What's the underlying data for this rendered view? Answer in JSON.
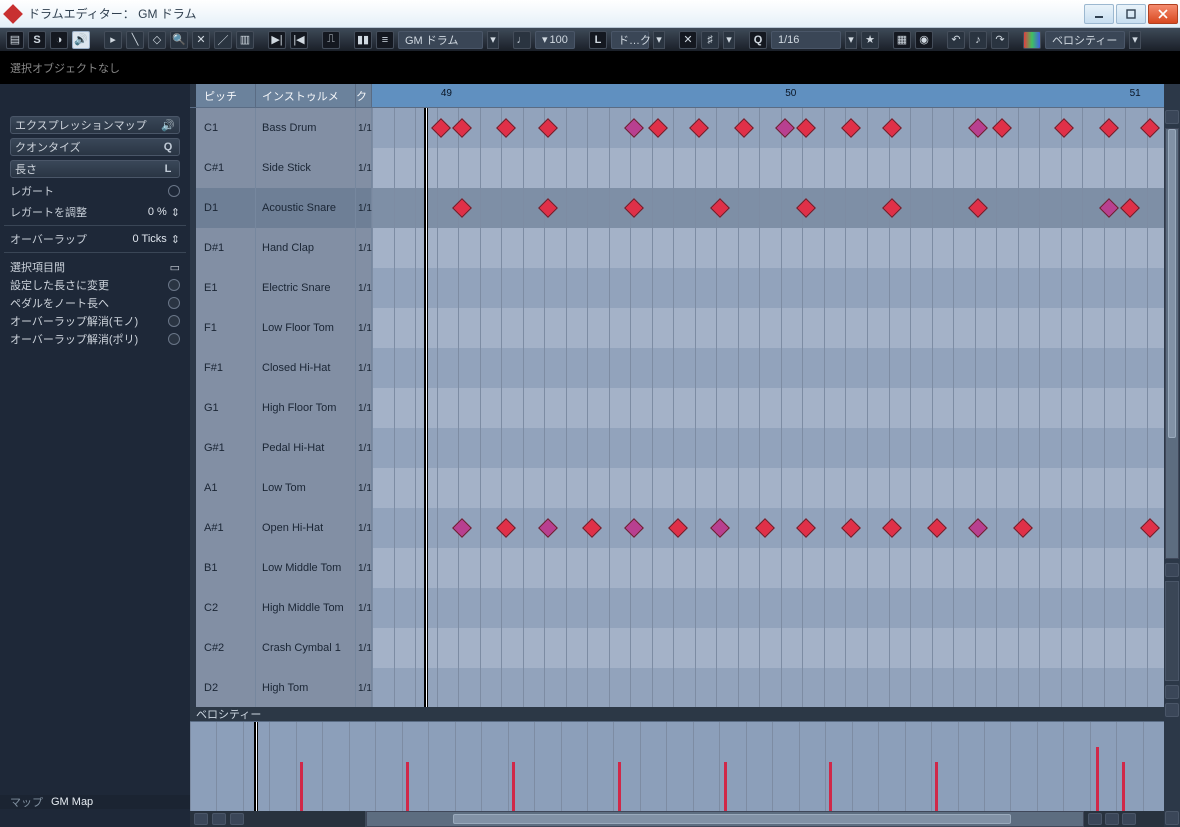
{
  "title": "ドラムエディター： GM ドラム",
  "toolbar": {
    "mapLabel": "GM ドラム",
    "tempo": "100",
    "lenLabel": "ド…ク",
    "snap": "1/16",
    "velField": "ベロシティー"
  },
  "infobar": "選択オブジェクトなし",
  "sidebar": {
    "expressionMap": "エクスプレッションマップ",
    "quantize": "クオンタイズ",
    "length": "長さ",
    "legato": "レガート",
    "legatoAdjust": "レガートを調整",
    "legatoAdjustVal": "0 %",
    "overlap": "オーバーラップ",
    "overlapVal": "0 Ticks",
    "selection": "選択項目間",
    "actions": [
      "設定した長さに変更",
      "ペダルをノート長へ",
      "オーバーラップ解消(モノ)",
      "オーバーラップ解消(ポリ)"
    ],
    "bottomMap": "マップ",
    "bottomMapVal": "GM Map",
    "velLabel": "ベロシティー"
  },
  "headers": {
    "pitch": "ピッチ",
    "instrument": "インストゥルメ",
    "q": "ク"
  },
  "ruler": {
    "t49": "49",
    "t50": "50",
    "t51": "51"
  },
  "rows": [
    {
      "pitch": "C1",
      "instr": "Bass Drum",
      "q": "1/1"
    },
    {
      "pitch": "C#1",
      "instr": "Side Stick",
      "q": "1/1"
    },
    {
      "pitch": "D1",
      "instr": "Acoustic Snare",
      "q": "1/1"
    },
    {
      "pitch": "D#1",
      "instr": "Hand Clap",
      "q": "1/1"
    },
    {
      "pitch": "E1",
      "instr": "Electric Snare",
      "q": "1/1"
    },
    {
      "pitch": "F1",
      "instr": "Low Floor Tom",
      "q": "1/1"
    },
    {
      "pitch": "F#1",
      "instr": "Closed Hi-Hat",
      "q": "1/1"
    },
    {
      "pitch": "G1",
      "instr": "High Floor Tom",
      "q": "1/1"
    },
    {
      "pitch": "G#1",
      "instr": "Pedal Hi-Hat",
      "q": "1/1"
    },
    {
      "pitch": "A1",
      "instr": "Low Tom",
      "q": "1/1"
    },
    {
      "pitch": "A#1",
      "instr": "Open Hi-Hat",
      "q": "1/1"
    },
    {
      "pitch": "B1",
      "instr": "Low Middle Tom",
      "q": "1/1"
    },
    {
      "pitch": "C2",
      "instr": "High Middle Tom",
      "q": "1/1"
    },
    {
      "pitch": "C#2",
      "instr": "Crash Cymbal 1",
      "q": "1/1"
    },
    {
      "pitch": "D2",
      "instr": "High Tom",
      "q": "1/1"
    }
  ],
  "grid": {
    "startTick": 48.8,
    "endTick": 51.1,
    "playhead": 48.95,
    "bars": [
      49,
      50,
      51
    ],
    "subdiv": 16,
    "events": {
      "0": [
        {
          "t": 49.0,
          "c": "r"
        },
        {
          "t": 49.06,
          "c": "r"
        },
        {
          "t": 49.19,
          "c": "r"
        },
        {
          "t": 49.31,
          "c": "r"
        },
        {
          "t": 49.56,
          "c": "m"
        },
        {
          "t": 49.63,
          "c": "r"
        },
        {
          "t": 49.75,
          "c": "r"
        },
        {
          "t": 49.88,
          "c": "r"
        },
        {
          "t": 50.0,
          "c": "m"
        },
        {
          "t": 50.06,
          "c": "r"
        },
        {
          "t": 50.19,
          "c": "r"
        },
        {
          "t": 50.31,
          "c": "r"
        },
        {
          "t": 50.56,
          "c": "m"
        },
        {
          "t": 50.63,
          "c": "r"
        },
        {
          "t": 50.81,
          "c": "r"
        },
        {
          "t": 50.94,
          "c": "r"
        },
        {
          "t": 51.06,
          "c": "r"
        }
      ],
      "2": [
        {
          "t": 49.06,
          "c": "r"
        },
        {
          "t": 49.31,
          "c": "r"
        },
        {
          "t": 49.56,
          "c": "r"
        },
        {
          "t": 49.81,
          "c": "r"
        },
        {
          "t": 50.06,
          "c": "r"
        },
        {
          "t": 50.31,
          "c": "r"
        },
        {
          "t": 50.56,
          "c": "r"
        },
        {
          "t": 50.94,
          "c": "m"
        },
        {
          "t": 51.0,
          "c": "r"
        }
      ],
      "10": [
        {
          "t": 49.06,
          "c": "m"
        },
        {
          "t": 49.19,
          "c": "r"
        },
        {
          "t": 49.31,
          "c": "m"
        },
        {
          "t": 49.44,
          "c": "r"
        },
        {
          "t": 49.56,
          "c": "m"
        },
        {
          "t": 49.69,
          "c": "r"
        },
        {
          "t": 49.81,
          "c": "m"
        },
        {
          "t": 49.94,
          "c": "r"
        },
        {
          "t": 50.06,
          "c": "r"
        },
        {
          "t": 50.19,
          "c": "r"
        },
        {
          "t": 50.31,
          "c": "r"
        },
        {
          "t": 50.44,
          "c": "r"
        },
        {
          "t": 50.56,
          "c": "m"
        },
        {
          "t": 50.69,
          "c": "r"
        },
        {
          "t": 51.06,
          "c": "r"
        }
      ]
    }
  },
  "velocity": [
    {
      "t": 49.06,
      "h": 0.55
    },
    {
      "t": 49.31,
      "h": 0.55
    },
    {
      "t": 49.56,
      "h": 0.55
    },
    {
      "t": 49.81,
      "h": 0.55
    },
    {
      "t": 50.06,
      "h": 0.55
    },
    {
      "t": 50.31,
      "h": 0.55
    },
    {
      "t": 50.56,
      "h": 0.55
    },
    {
      "t": 50.94,
      "h": 0.72
    },
    {
      "t": 51.0,
      "h": 0.55
    }
  ]
}
